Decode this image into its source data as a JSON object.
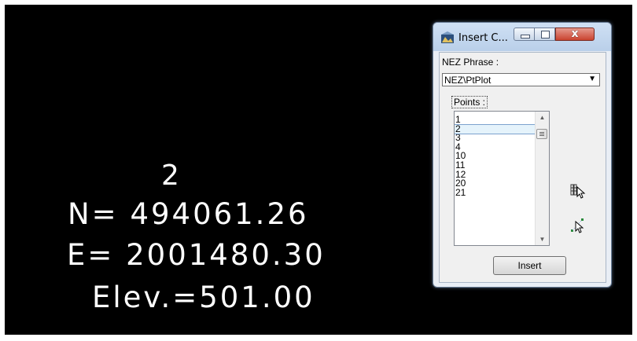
{
  "cad_view": {
    "point_number": "2",
    "northing_line": "N= 494061.26",
    "easting_line": "E= 2001480.30",
    "elevation_line": "Elev.=501.00"
  },
  "dialog": {
    "title": "Insert C...",
    "close_glyph": "x",
    "nez_phrase_label": "NEZ Phrase :",
    "nez_phrase_value": "NEZ\\PtPlot",
    "points_label": "Points :",
    "points": [
      "1",
      "2",
      "3",
      "4",
      "10",
      "11",
      "12",
      "20",
      "21"
    ],
    "selected_point": "2",
    "insert_label": "Insert"
  }
}
